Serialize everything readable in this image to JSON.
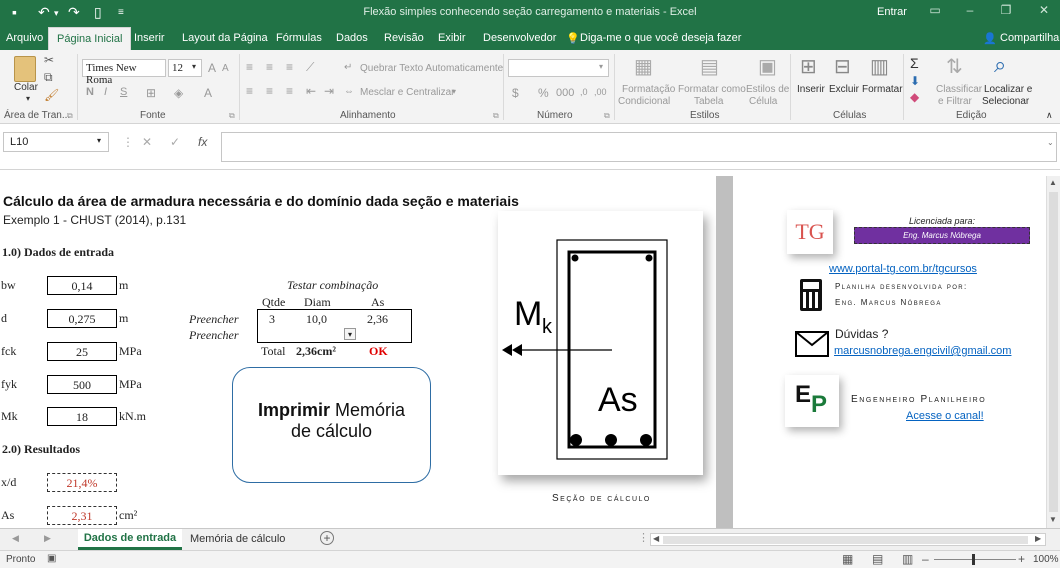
{
  "titlebar": {
    "title": "Flexão simples conhecendo seção carregamento e materiais  -  Excel",
    "signin": "Entrar"
  },
  "tabs": [
    "Arquivo",
    "Página Inicial",
    "Inserir",
    "Layout da Página",
    "Fórmulas",
    "Dados",
    "Revisão",
    "Exibir",
    "Desenvolvedor"
  ],
  "tell_me": "Diga-me o que você deseja fazer",
  "share": "Compartilhar",
  "ribbon": {
    "paste": "Colar",
    "font_name": "Times New Roma",
    "font_size": "12",
    "wrap_text": "Quebrar Texto Automaticamente",
    "merge_center": "Mesclar e Centralizar",
    "cond_format_1": "Formatação",
    "cond_format_2": "Condicional",
    "format_table_1": "Formatar como",
    "format_table_2": "Tabela",
    "cell_styles_1": "Estilos de",
    "cell_styles_2": "Célula",
    "insert": "Inserir",
    "delete": "Excluir",
    "format": "Formatar",
    "sort_1": "Classificar",
    "sort_2": "e Filtrar",
    "find_1": "Localizar e",
    "find_2": "Selecionar",
    "groups": {
      "clipboard": "Área de Tran...",
      "font": "Fonte",
      "alignment": "Alinhamento",
      "number": "Número",
      "styles": "Estilos",
      "cells": "Células",
      "editing": "Edição"
    }
  },
  "formula_bar": {
    "name_box": "L10",
    "formula": ""
  },
  "sheet": {
    "title": "Cálculo da área de armadura necessária e do domínio dada seção e materiais",
    "subtitle": "Exemplo 1 - CHUST (2014), p.131",
    "section1": "1.0) Dados de entrada",
    "inputs": [
      {
        "label": "bw",
        "value": "0,14",
        "unit": "m"
      },
      {
        "label": "d",
        "value": "0,275",
        "unit": "m"
      },
      {
        "label": "fck",
        "value": "25",
        "unit": "MPa"
      },
      {
        "label": "fyk",
        "value": "500",
        "unit": "MPa"
      },
      {
        "label": "Mk",
        "value": "18",
        "unit": "kN.m"
      }
    ],
    "section2": "2.0) Resultados",
    "results": [
      {
        "label": "x/d",
        "value": "21,4%",
        "unit": ""
      },
      {
        "label": "As",
        "value": "2,31",
        "unit": "cm²"
      }
    ],
    "test_title": "Testar combinação",
    "test_headers": [
      "Qtde",
      "Diam",
      "As"
    ],
    "test_row": [
      "3",
      "10,0",
      "2,36"
    ],
    "fill_labels": [
      "Preencher",
      "Preencher"
    ],
    "total_label": "Total",
    "total_value": "2,36cm²",
    "total_status": "OK",
    "print_bold": "Imprimir",
    "print_rest": " Memória",
    "print_line2": "de cálculo",
    "section_moment": "M",
    "section_moment_sub": "k",
    "section_as": "As",
    "section_caption": "Seção de cálculo"
  },
  "right_pane": {
    "licensed_for": "Licenciada para:",
    "licensee": "Eng. Marcus Nóbrega",
    "tg_logo": "TG",
    "link": "www.portal-tg.com.br/tgcursos",
    "developed_by": "Planilha desenvolvida por:",
    "author": "Eng. Marcus Nóbrega",
    "questions": "Dúvidas ?",
    "email": "marcusnobrega.engcivil@gmail.com",
    "ep_logo_e": "E",
    "ep_logo_p": "P",
    "channel_name": "Engenheiro Planilheiro",
    "channel_link": "Acesse o canal!"
  },
  "sheet_tabs": [
    "Dados de entrada",
    "Memória de cálculo"
  ],
  "status": {
    "ready": "Pronto",
    "zoom": "100%"
  },
  "colors": {
    "excel_green": "#217346",
    "license_purple": "#7030a0",
    "result_red": "#c0392b",
    "ok_red": "#e00000",
    "link_blue": "#0563c1",
    "ep_green": "#1a7a3a",
    "tg_red": "#d9534f"
  }
}
